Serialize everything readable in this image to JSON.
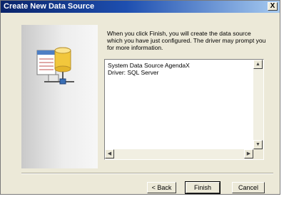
{
  "window": {
    "title": "Create New Data Source",
    "close_symbol": "X"
  },
  "message": {
    "lines": [
      "When you click Finish, you will create the data source",
      "which you have just configured.  The driver may prompt you",
      "for more information."
    ]
  },
  "summary": {
    "lines": [
      "System Data Source AgendaX",
      "Driver:  SQL Server"
    ]
  },
  "scrollbars": {
    "up_icon": "triangle-up-icon",
    "down_icon": "triangle-down-icon",
    "left_icon": "triangle-left-icon",
    "right_icon": "triangle-right-icon"
  },
  "buttons": {
    "back": "< Back",
    "finish": "Finish",
    "cancel": "Cancel"
  },
  "graphic": {
    "icon": "data-source-icon"
  }
}
